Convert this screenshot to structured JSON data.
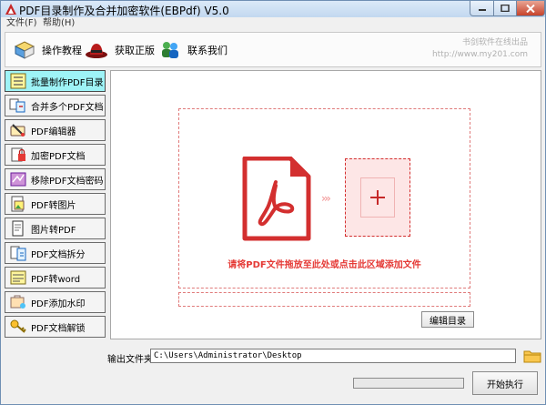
{
  "window": {
    "title": "PDF目录制作及合并加密软件(EBPdf) V5.0"
  },
  "menu": [
    {
      "label": "文件(F)"
    },
    {
      "label": "帮助(H)"
    }
  ],
  "toolbar": {
    "items": [
      {
        "label": "操作教程",
        "icon": "book-icon"
      },
      {
        "label": "获取正版",
        "icon": "hat-icon"
      },
      {
        "label": "联系我们",
        "icon": "people-icon"
      }
    ],
    "watermark_line1": "书剑软件在线出品",
    "watermark_line2": "http://www.my201.com"
  },
  "sidebar": {
    "items": [
      {
        "label": "批量制作PDF目录",
        "icon": "list-icon",
        "active": true
      },
      {
        "label": "合并多个PDF文档",
        "icon": "merge-icon"
      },
      {
        "label": "PDF编辑器",
        "icon": "editor-icon"
      },
      {
        "label": "加密PDF文档",
        "icon": "lock-icon"
      },
      {
        "label": "移除PDF文档密码",
        "icon": "unlock-icon"
      },
      {
        "label": "PDF转图片",
        "icon": "image-icon"
      },
      {
        "label": "图片转PDF",
        "icon": "document-icon"
      },
      {
        "label": "PDF文档拆分",
        "icon": "split-icon"
      },
      {
        "label": "PDF转word",
        "icon": "word-icon"
      },
      {
        "label": "PDF添加水印",
        "icon": "watermark-icon"
      },
      {
        "label": "PDF文档解锁",
        "icon": "key-icon"
      }
    ]
  },
  "dropzone": {
    "text": "请将PDF文件拖放至此处或点击此区域添加文件"
  },
  "buttons": {
    "edit_toc": "编辑目录",
    "start": "开始执行"
  },
  "output": {
    "label": "输出文件夹",
    "path": "C:\\Users\\Administrator\\Desktop"
  },
  "progress": {
    "value": 0
  },
  "colors": {
    "accent_red": "#d32f2f",
    "active_sidebar": "#9ef3f6"
  }
}
